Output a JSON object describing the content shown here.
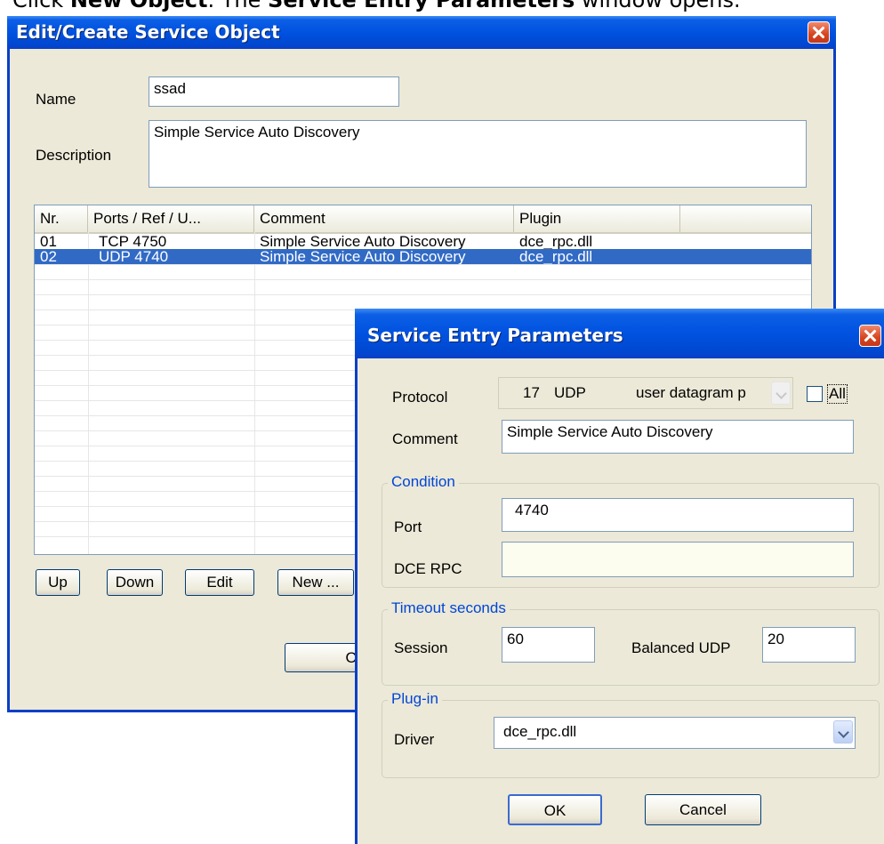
{
  "caption": {
    "prefix": "Click ",
    "bold1": "New Object",
    "middle": ". The ",
    "bold2": "Service Entry Parameters",
    "suffix": " window opens."
  },
  "edit_window": {
    "title": "Edit/Create Service Object",
    "name_label": "Name",
    "name_value": "ssad",
    "description_label": "Description",
    "description_value": "Simple Service Auto Discovery",
    "columns": [
      "Nr.",
      "Ports / Ref / U...",
      "Comment",
      "Plugin"
    ],
    "rows": [
      {
        "nr": "01",
        "ports": "TCP  4750",
        "comment": "Simple Service Auto Discovery",
        "plugin": "dce_rpc.dll",
        "selected": false
      },
      {
        "nr": "02",
        "ports": "UDP  4740",
        "comment": "Simple Service Auto Discovery",
        "plugin": "dce_rpc.dll",
        "selected": true
      }
    ],
    "buttons": {
      "up": "Up",
      "down": "Down",
      "edit": "Edit",
      "new": "New ...",
      "ok": "OK"
    }
  },
  "service_entry": {
    "title": "Service Entry Parameters",
    "protocol_label": "Protocol",
    "protocol_number": "17",
    "protocol_name": "UDP",
    "protocol_desc": "user datagram p",
    "all_label": "All",
    "comment_label": "Comment",
    "comment_value": "Simple Service Auto Discovery",
    "condition_group": "Condition",
    "port_label": "Port",
    "port_value": "4740",
    "dce_rpc_label": "DCE RPC",
    "dce_rpc_value": "",
    "timeout_group": "Timeout seconds",
    "session_label": "Session",
    "session_value": "60",
    "balanced_udp_label": "Balanced UDP",
    "balanced_udp_value": "20",
    "plugin_group": "Plug-in",
    "driver_label": "Driver",
    "driver_value": "dce_rpc.dll",
    "ok_button": "OK",
    "cancel_button": "Cancel"
  },
  "colors": {
    "titlebar": "#0052e0",
    "window_bg": "#ece9d8",
    "selection": "#316ac5",
    "group_title": "#0046d5",
    "dce_rpc_field_bg": "#fdfdef"
  }
}
